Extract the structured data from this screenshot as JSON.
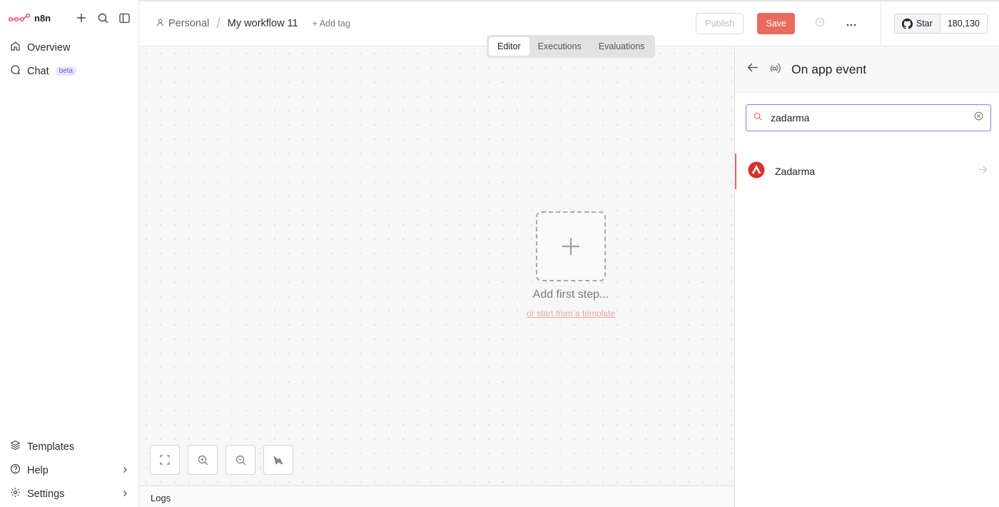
{
  "app": {
    "logo_text": "n8n"
  },
  "sidebar": {
    "items": [
      {
        "label": "Overview",
        "icon": "home-icon"
      },
      {
        "label": "Chat",
        "icon": "chat-icon",
        "badge": "beta"
      }
    ],
    "bottom_items": [
      {
        "label": "Templates",
        "icon": "templates-icon"
      },
      {
        "label": "Help",
        "icon": "help-icon"
      },
      {
        "label": "Settings",
        "icon": "settings-icon"
      }
    ]
  },
  "header": {
    "project": "Personal",
    "workflow_title": "My workflow 11",
    "add_tag": "+ Add tag",
    "publish_label": "Publish",
    "save_label": "Save",
    "github_star_label": "Star",
    "github_star_count": "180,130"
  },
  "tabs": [
    {
      "label": "Editor",
      "active": true
    },
    {
      "label": "Executions",
      "active": false
    },
    {
      "label": "Evaluations",
      "active": false
    }
  ],
  "canvas": {
    "add_first_step": "Add first step...",
    "template_link": "or start from a template"
  },
  "logs_label": "Logs",
  "panel": {
    "title": "On app event",
    "search_value": "zadarma",
    "results": [
      {
        "name": "Zadarma",
        "icon": "zadarma-icon"
      }
    ]
  },
  "colors": {
    "accent": "#ea6a5d",
    "focus": "#8d7cf0",
    "badge_bg": "#e9e7ff",
    "badge_text": "#6a59d6"
  }
}
